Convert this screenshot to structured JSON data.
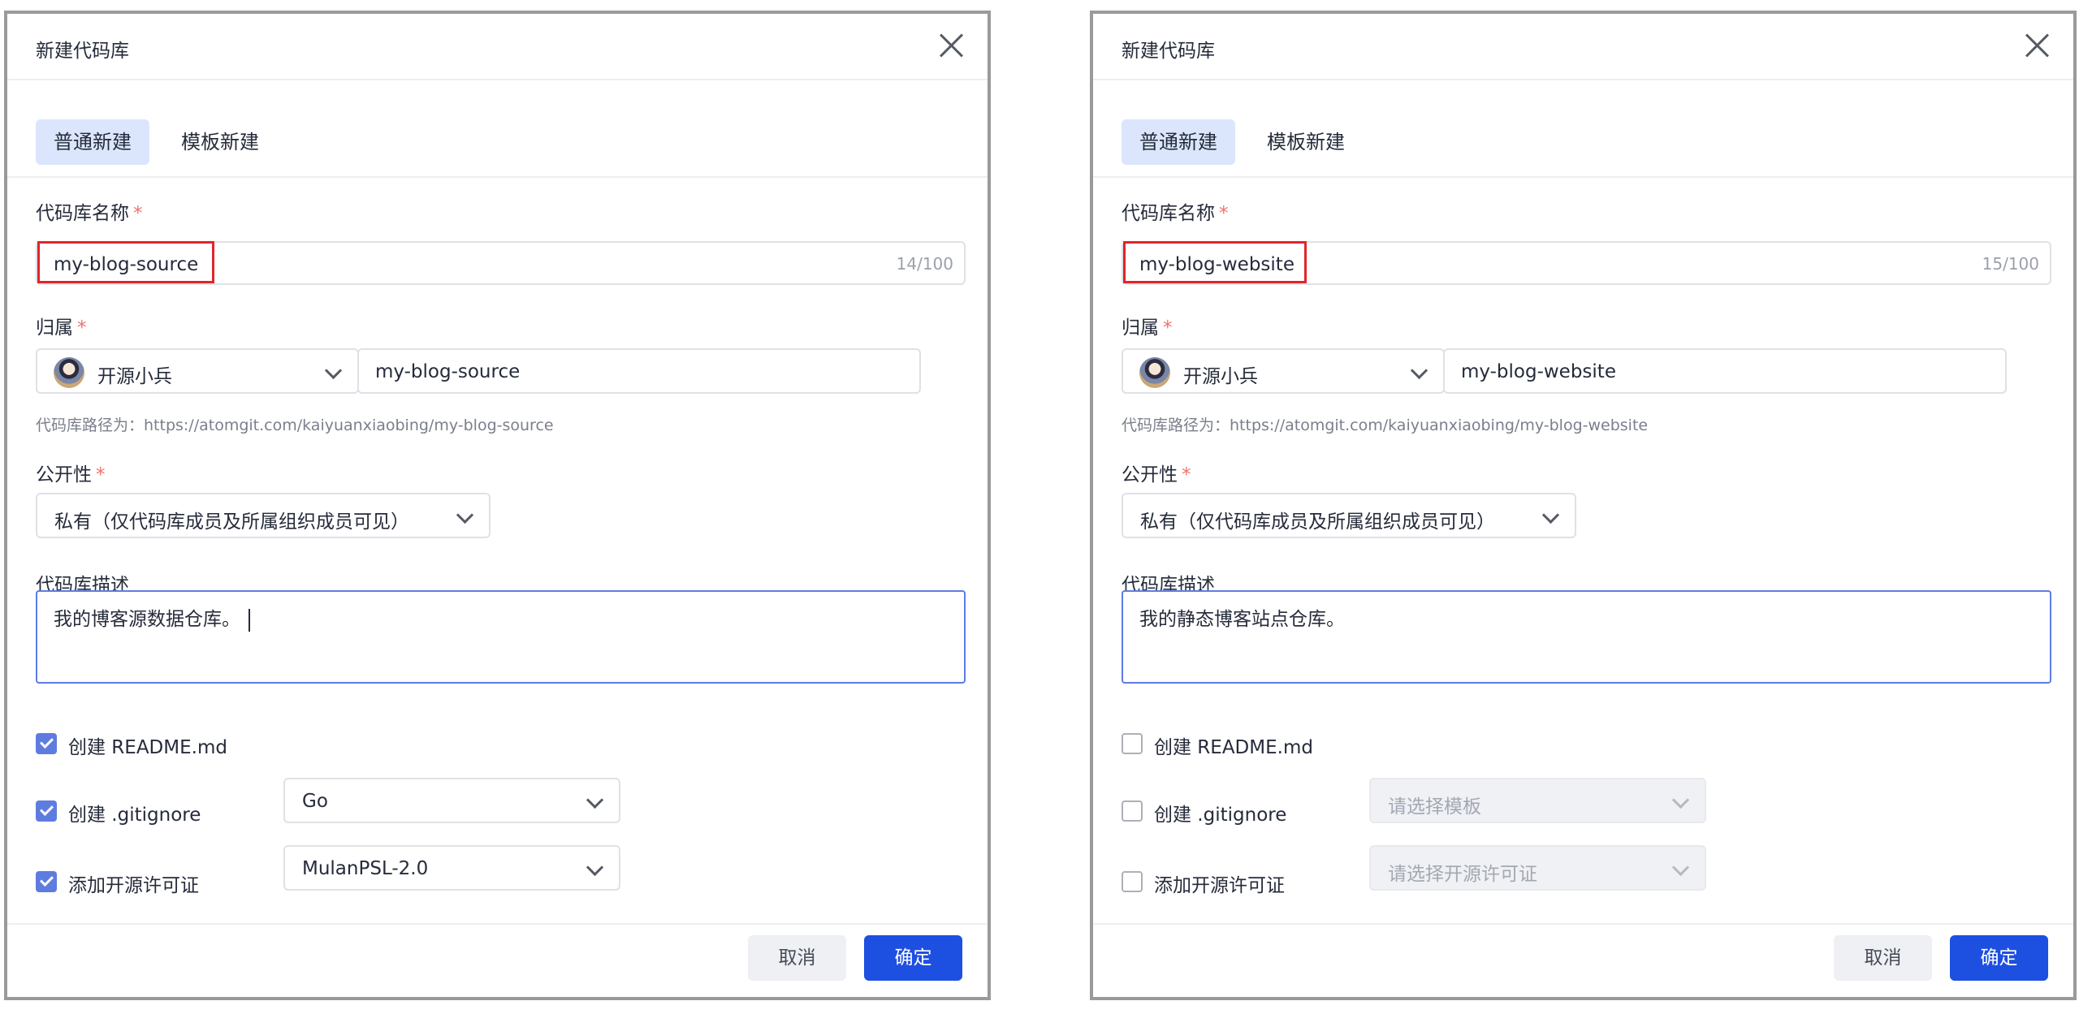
{
  "dialogs": [
    {
      "title": "新建代码库",
      "tabs": [
        "普通新建",
        "模板新建"
      ],
      "name_label": "代码库名称",
      "required_mark": "*",
      "name_value": "my-blog-source",
      "name_count": "14/100",
      "owner_label": "归属",
      "owner_name": "开源小兵",
      "path_value": "my-blog-source",
      "path_hint": "代码库路径为：https://atomgit.com/kaiyuanxiaobing/my-blog-source",
      "visibility_label": "公开性",
      "visibility_value": "私有（仅代码库成员及所属组织成员可见）",
      "desc_label": "代码库描述",
      "desc_value": "我的博客源数据仓库。",
      "readme_label": "创建 README.md",
      "readme_checked": true,
      "gitignore_label": "创建 .gitignore",
      "gitignore_checked": true,
      "gitignore_value": "Go",
      "license_label": "添加开源许可证",
      "license_checked": true,
      "license_value": "MulanPSL-2.0",
      "cancel": "取消",
      "confirm": "确定"
    },
    {
      "title": "新建代码库",
      "tabs": [
        "普通新建",
        "模板新建"
      ],
      "name_label": "代码库名称",
      "required_mark": "*",
      "name_value": "my-blog-website",
      "name_count": "15/100",
      "owner_label": "归属",
      "owner_name": "开源小兵",
      "path_value": "my-blog-website",
      "path_hint": "代码库路径为：https://atomgit.com/kaiyuanxiaobing/my-blog-website",
      "visibility_label": "公开性",
      "visibility_value": "私有（仅代码库成员及所属组织成员可见）",
      "desc_label": "代码库描述",
      "desc_value": "我的静态博客站点仓库。",
      "readme_label": "创建 README.md",
      "readme_checked": false,
      "gitignore_label": "创建 .gitignore",
      "gitignore_checked": false,
      "gitignore_placeholder": "请选择模板",
      "license_label": "添加开源许可证",
      "license_checked": false,
      "license_placeholder": "请选择开源许可证",
      "cancel": "取消",
      "confirm": "确定"
    }
  ],
  "colors": {
    "primary": "#5e7ce0",
    "confirm_bg": "#1d4fe0",
    "tab_active_bg": "#dbe6fd",
    "highlight_box": "#e1252a",
    "required": "#f66f6a"
  },
  "icons": [
    "close-icon",
    "chevron-down-icon",
    "check-icon",
    "avatar"
  ]
}
